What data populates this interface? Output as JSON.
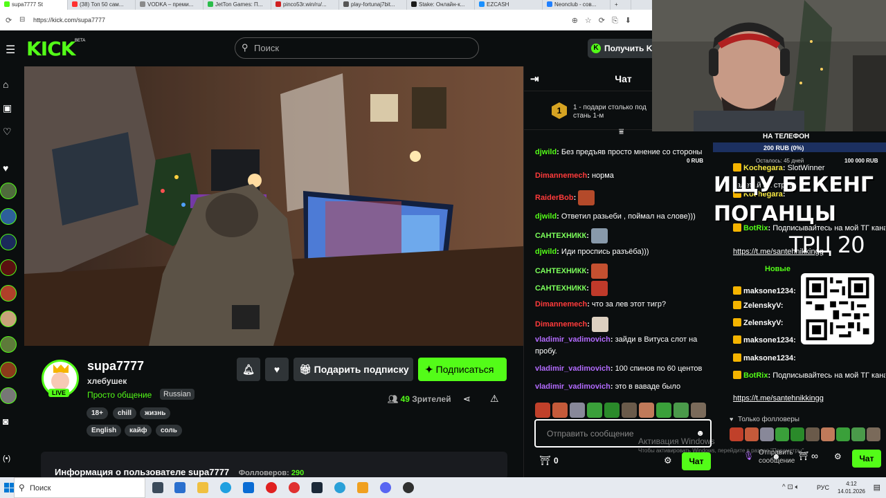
{
  "browser": {
    "tabs": [
      "supa7777 St",
      "(38) Топ 50 сам...",
      "VODKA – преми...",
      "JetTon Games: П...",
      "pinco53r.win/ru/...",
      "play-fortunaj7bit...",
      "Stake: Онлайн-к...",
      "EZCASH",
      "Neonclub - сов..."
    ],
    "new_tab": "+",
    "url": "https://kick.com/supa7777"
  },
  "header": {
    "logo": "KICK",
    "beta": "BETA",
    "search_placeholder": "Поиск",
    "get_button": "Получить K"
  },
  "channel": {
    "name": "supa7777",
    "title": "хлебушек",
    "category": "Просто общение",
    "language": "Russian",
    "live": "LIVE",
    "tags_row1": [
      "18+",
      "chill",
      "жизнь"
    ],
    "tags_row2": [
      "English",
      "кайф",
      "соль"
    ],
    "gift_button": "Подарить подписку",
    "subscribe_button": "Подписаться",
    "viewers_count": "49",
    "viewers_label": "Зрителей",
    "info_title": "Информация о пользователе supa7777",
    "followers_label": "Фолловеров:",
    "followers_count": "290"
  },
  "chat": {
    "title": "Чат",
    "pinned": "1 - подари столько под\nстань 1-м",
    "pinned_rank": "1",
    "messages": [
      {
        "user": "djwild",
        "text": "Без предъяв просто мнение со стороны",
        "color": "#53fc18"
      },
      {
        "user": "Dimannemech",
        "text": "норма",
        "color": "#ff3b3b"
      },
      {
        "user": "RaiderBob",
        "text": "",
        "color": "#ff3b3b"
      },
      {
        "user": "djwild",
        "text": "Ответил разьеби , поймал на слове)))",
        "color": "#53fc18"
      },
      {
        "user": "САНТЕХНИКК",
        "text": "",
        "color": "#7cff5b"
      },
      {
        "user": "djwild",
        "text": "Иди проспись разъёба)))",
        "color": "#53fc18"
      },
      {
        "user": "САНТЕХНИКК",
        "text": "",
        "color": "#7cff5b"
      },
      {
        "user": "САНТЕХНИКК",
        "text": "",
        "color": "#7cff5b"
      },
      {
        "user": "Dimannemech",
        "text": "что за лев этот тигр?",
        "color": "#ff3b3b"
      },
      {
        "user": "Dimannemech",
        "text": "",
        "color": "#ff3b3b"
      },
      {
        "user": "vladimir_vadimovich",
        "text": "зайди в Витуса слот на пробу.",
        "color": "#b36bff"
      },
      {
        "user": "vladimir_vadimovich",
        "text": "100 спинов по 60 центов",
        "color": "#b36bff"
      },
      {
        "user": "vladimir_vadimovich",
        "text": "это в ваваде было",
        "color": "#b36bff"
      }
    ],
    "input_placeholder": "Отправить сообщение",
    "points": "0",
    "send_button": "Чат"
  },
  "overlay": {
    "goal_title": "НА ТЕЛЕФОН",
    "goal_amount": "200 RUB (0%)",
    "goal_left": "Осталось: 45 дней",
    "goal_target": "100 000 RUB",
    "goal_current": "0 RUB",
    "big_text_1": "ИЩУ БЕКЕНГ",
    "big_text_2": "ПОГАНЦЫ",
    "big_text_3": "ТРЦ 20",
    "side_chat": [
      {
        "user": "Kochegara",
        "text": "SlotWinner",
        "color": "#f5e642"
      },
      {
        "user": "",
        "text": "залетай на стрим",
        "color": "#ffffff"
      },
      {
        "user": "Kochegara",
        "text": "",
        "color": "#f5e642"
      },
      {
        "user": "BotRix",
        "text": "Подписывайтесь на мой ТГ канал -",
        "color": "#53fc18"
      },
      {
        "user": "",
        "text": "https://t.me/santehnikkingg",
        "color": "#ffffff"
      },
      {
        "user": "",
        "text": "Новые",
        "color": "#53fc18"
      },
      {
        "user": "maksone1234",
        "text": "",
        "color": "#ffffff"
      },
      {
        "user": "ZelenskyV",
        "text": "",
        "color": "#ffffff"
      },
      {
        "user": "ZelenskyV",
        "text": "",
        "color": "#ffffff"
      },
      {
        "user": "maksone1234",
        "text": "",
        "color": "#ffffff"
      },
      {
        "user": "maksone1234",
        "text": "",
        "color": "#ffffff"
      },
      {
        "user": "BotRix",
        "text": "Подписывайтесь на мой ТГ канал -",
        "color": "#53fc18"
      },
      {
        "user": "",
        "text": "https://t.me/santehnikkingg",
        "color": "#ffffff"
      }
    ],
    "followers_only": "Только фолловеры",
    "send_placeholder": "Отправить сообщение",
    "chat_button": "Чат"
  },
  "activation": {
    "title": "Активация Windows",
    "subtitle": "Чтобы активировать Windows, перейдите в раздел \"Параметры\"."
  },
  "taskbar": {
    "search": "Поиск",
    "lang": "РУС",
    "time": "4:12",
    "date": "14.01.2026"
  }
}
